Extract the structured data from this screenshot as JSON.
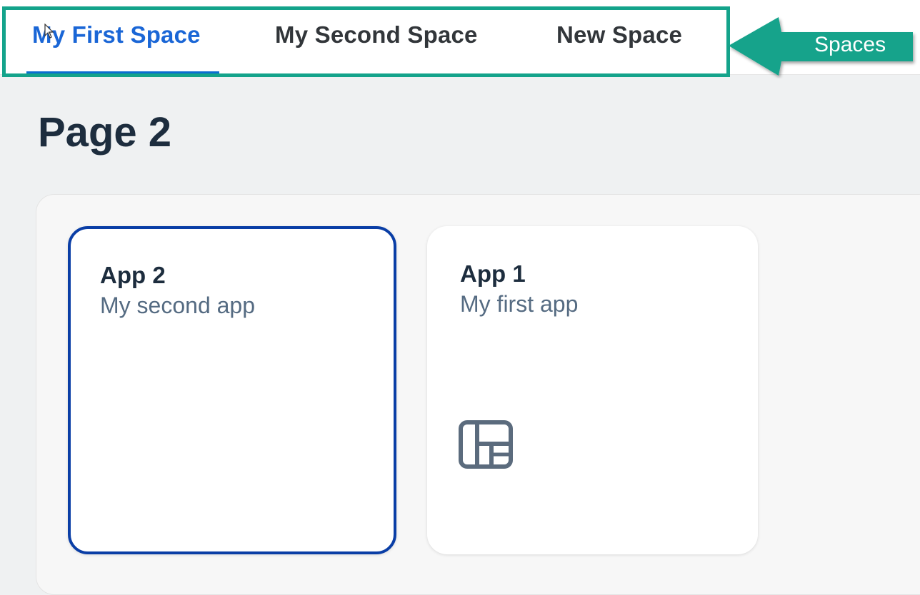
{
  "spaces": {
    "tabs": [
      {
        "label": "My First Space",
        "active": true
      },
      {
        "label": "My Second Space",
        "active": false
      },
      {
        "label": "New Space",
        "active": false
      }
    ],
    "active_color": "#1a66d6"
  },
  "callout": {
    "label": "Spaces",
    "color": "#14a38b"
  },
  "page": {
    "title": "Page 2"
  },
  "tiles": [
    {
      "title": "App 2",
      "subtitle": "My second app",
      "selected": true,
      "icon": null
    },
    {
      "title": "App 1",
      "subtitle": "My first app",
      "selected": false,
      "icon": "layout-grid-icon"
    }
  ]
}
